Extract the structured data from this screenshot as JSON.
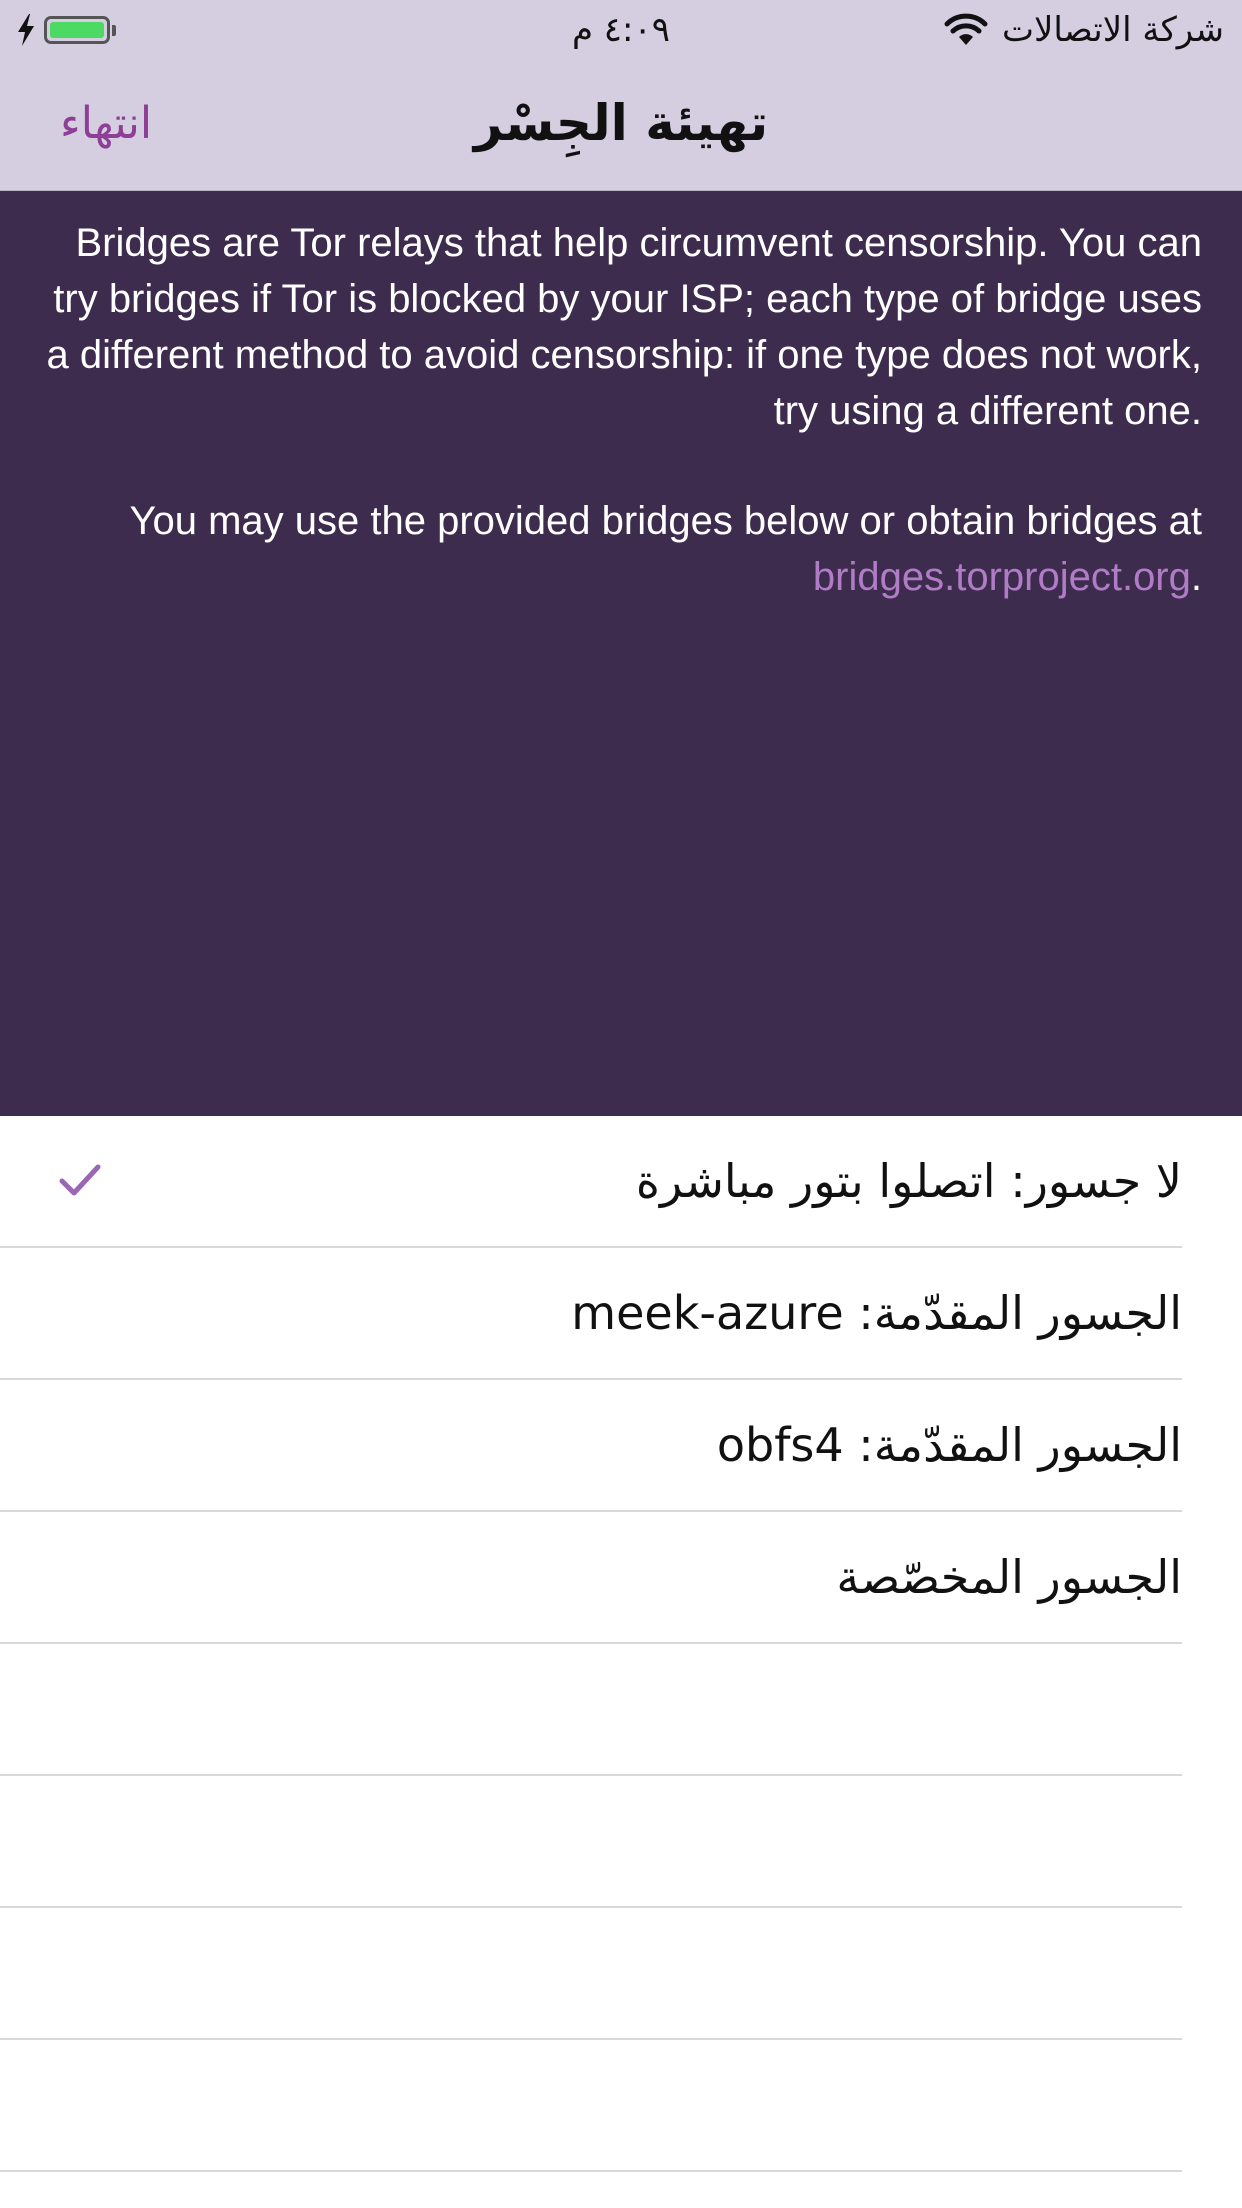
{
  "status_bar": {
    "time": "٤:٠٩ م",
    "carrier": "شركة الاتصالات"
  },
  "nav": {
    "title": "تهيئة الجِسْر",
    "done_label": "انتهاء"
  },
  "info": {
    "paragraph1": "Bridges are Tor relays that help circumvent censorship. You can try bridges if Tor is blocked by your ISP; each type of bridge uses a different method to avoid censorship: if one type does not work, try using a different one.",
    "paragraph2_prefix": "You may use the provided bridges below or obtain bridges at",
    "link_text": "bridges.torproject.org",
    "paragraph2_suffix": "."
  },
  "options": [
    {
      "label": "لا جسور: اتصلوا بتور مباشرة",
      "selected": true
    },
    {
      "label": "الجسور المقدّمة: meek-azure",
      "selected": false
    },
    {
      "label": "الجسور المقدّمة: obfs4",
      "selected": false
    },
    {
      "label": "الجسور المخصّصة",
      "selected": false
    }
  ],
  "colors": {
    "accent": "#8e3f95",
    "panel_bg": "#3e2c4f",
    "bar_bg": "#d4cee0",
    "link": "#b07cc6",
    "battery": "#4cd964"
  },
  "icons": {
    "charging": "bolt-icon",
    "battery": "battery-icon",
    "wifi": "wifi-icon",
    "selected": "checkmark-icon"
  }
}
